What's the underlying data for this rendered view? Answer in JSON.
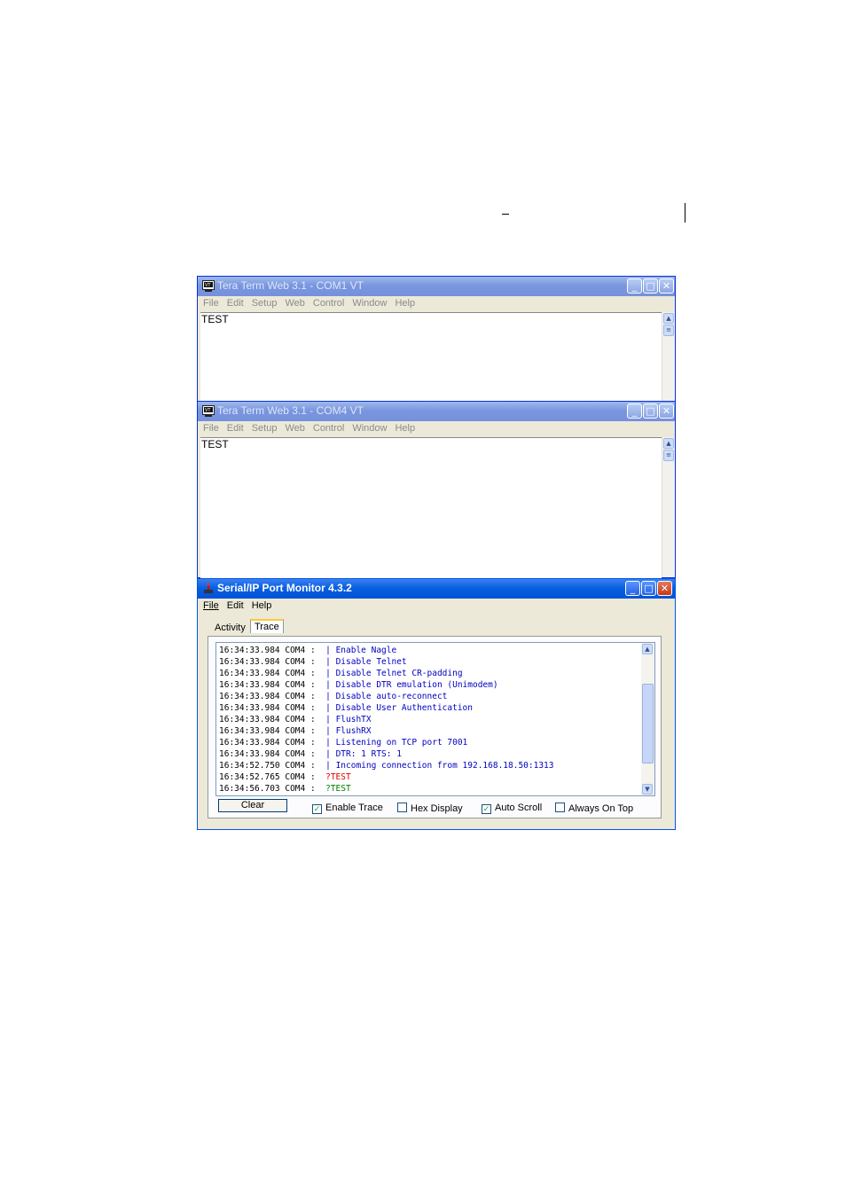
{
  "tt_com1": {
    "title": "Tera Term Web 3.1 - COM1 VT",
    "menu": [
      "File",
      "Edit",
      "Setup",
      "Web",
      "Control",
      "Window",
      "Help"
    ],
    "content": "TEST"
  },
  "tt_com4": {
    "title": "Tera Term Web 3.1 - COM4 VT",
    "menu": [
      "File",
      "Edit",
      "Setup",
      "Web",
      "Control",
      "Window",
      "Help"
    ],
    "content": "TEST"
  },
  "monitor": {
    "title": "Serial/IP Port Monitor 4.3.2",
    "menu": [
      "File",
      "Edit",
      "Help"
    ],
    "tabs": [
      "Activity",
      "Trace"
    ],
    "active_tab": "Trace",
    "trace": [
      {
        "time": "16:34:33.984",
        "port": "COM4",
        "sep": "|",
        "msg": "Enable Nagle",
        "color": "#0000c0"
      },
      {
        "time": "16:34:33.984",
        "port": "COM4",
        "sep": "|",
        "msg": "Disable Telnet",
        "color": "#0000c0"
      },
      {
        "time": "16:34:33.984",
        "port": "COM4",
        "sep": "|",
        "msg": "Disable Telnet CR-padding",
        "color": "#0000c0"
      },
      {
        "time": "16:34:33.984",
        "port": "COM4",
        "sep": "|",
        "msg": "Disable DTR emulation (Unimodem)",
        "color": "#0000c0"
      },
      {
        "time": "16:34:33.984",
        "port": "COM4",
        "sep": "|",
        "msg": "Disable auto-reconnect",
        "color": "#0000c0"
      },
      {
        "time": "16:34:33.984",
        "port": "COM4",
        "sep": "|",
        "msg": "Disable User Authentication",
        "color": "#0000c0"
      },
      {
        "time": "16:34:33.984",
        "port": "COM4",
        "sep": "|",
        "msg": "FlushTX",
        "color": "#0000c0"
      },
      {
        "time": "16:34:33.984",
        "port": "COM4",
        "sep": "|",
        "msg": "FlushRX",
        "color": "#0000c0"
      },
      {
        "time": "16:34:33.984",
        "port": "COM4",
        "sep": "|",
        "msg": "Listening on TCP port 7001",
        "color": "#0000c0"
      },
      {
        "time": "16:34:33.984",
        "port": "COM4",
        "sep": "|",
        "msg": "DTR: 1 RTS: 1",
        "color": "#0000c0"
      },
      {
        "time": "16:34:52.750",
        "port": "COM4",
        "sep": "|",
        "msg": "Incoming connection from 192.168.18.50:1313",
        "color": "#0000c0"
      },
      {
        "time": "16:34:52.765",
        "port": "COM4",
        "sep": "",
        "msg": "?TEST",
        "color": "#e00000"
      },
      {
        "time": "16:34:56.703",
        "port": "COM4",
        "sep": "",
        "msg": "?TEST",
        "color": "#008000"
      }
    ],
    "scroll_position": 0.6,
    "clear_label": "Clear",
    "options": [
      {
        "label": "Enable Trace",
        "checked": true
      },
      {
        "label": "Hex Display",
        "checked": false
      },
      {
        "label": "Auto Scroll",
        "checked": true
      },
      {
        "label": "Always On Top",
        "checked": false
      }
    ]
  },
  "icons": {
    "minimize": "minimize-icon",
    "maximize": "maximize-icon",
    "close": "close-icon",
    "scroll_up": "scroll-up-arrow-icon",
    "scroll_down": "scroll-down-arrow-icon",
    "checkmark": "checkmark-icon"
  }
}
